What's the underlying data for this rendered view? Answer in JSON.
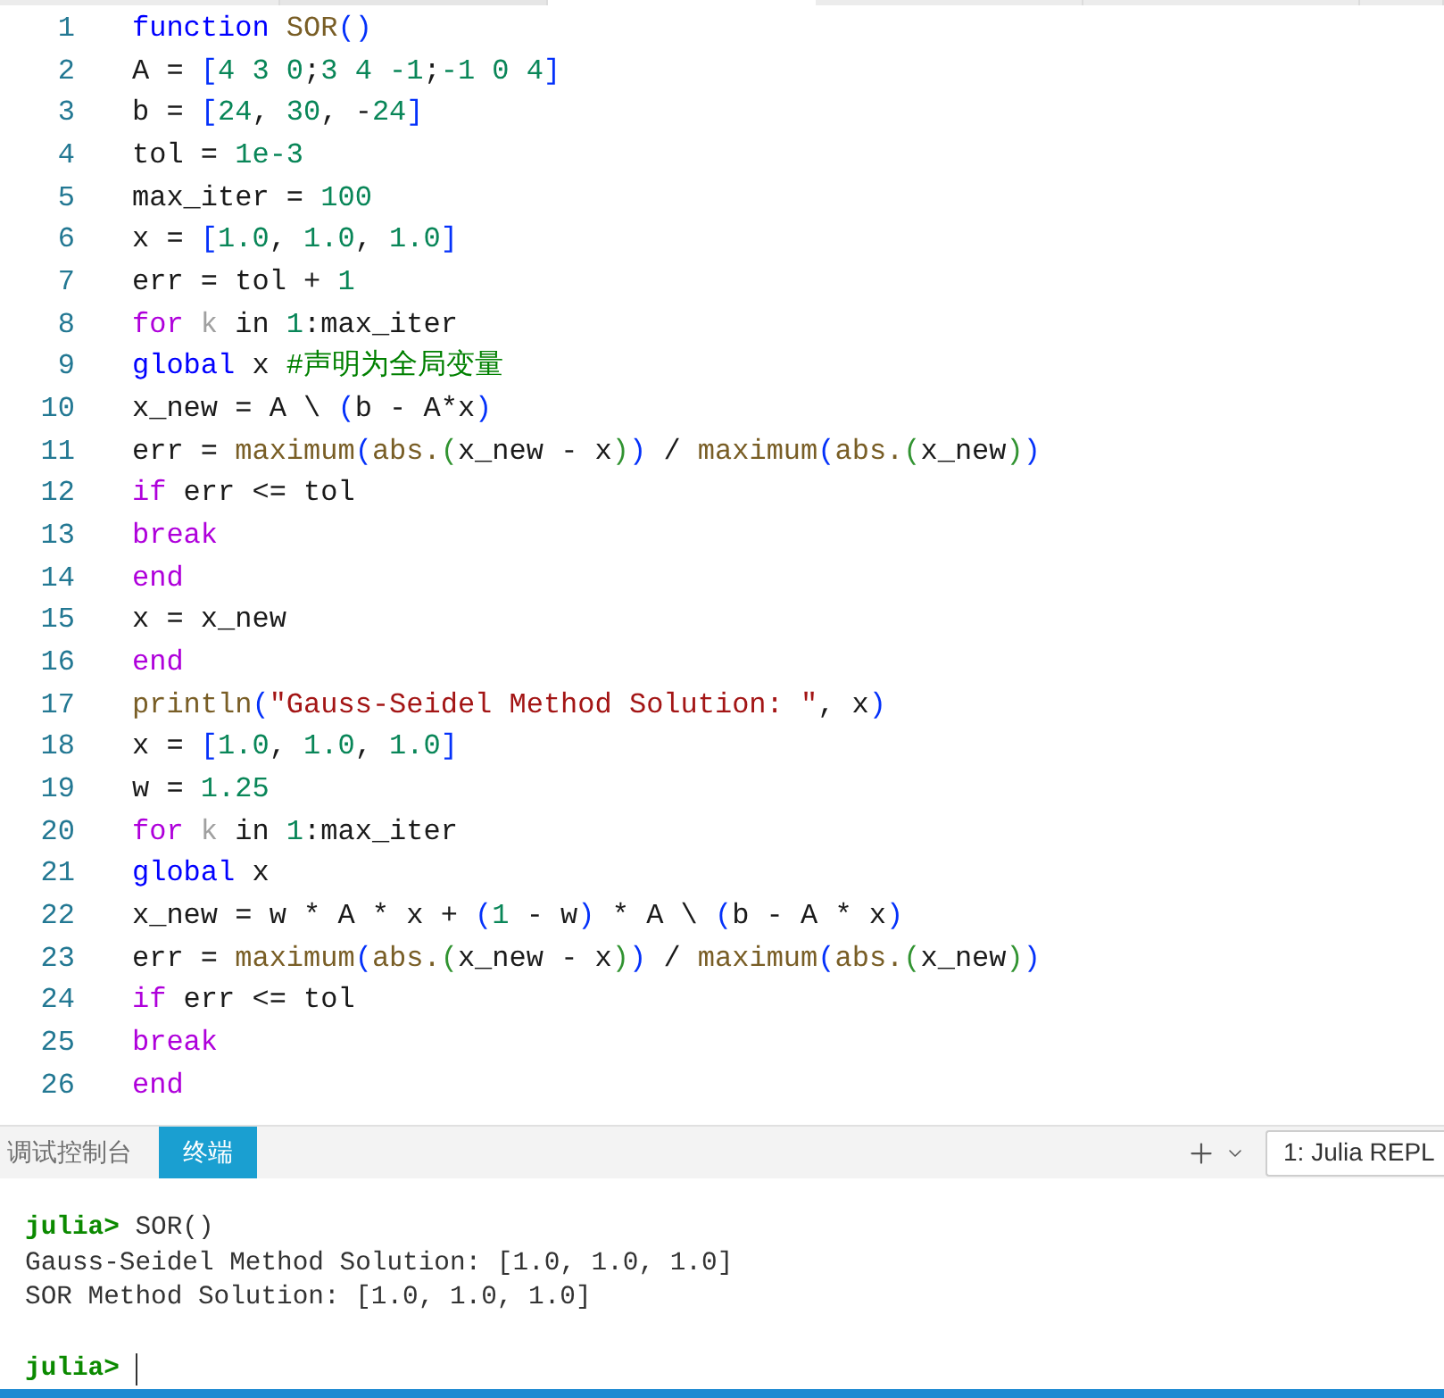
{
  "editor": {
    "lines": [
      {
        "number": "1",
        "tokens": [
          {
            "kind": "keyword",
            "text": "function "
          },
          {
            "kind": "function",
            "text": "SOR"
          },
          {
            "kind": "bracket_1",
            "text": "()"
          }
        ]
      },
      {
        "number": "2",
        "tokens": [
          {
            "kind": "plain",
            "text": "A = "
          },
          {
            "kind": "bracket_1",
            "text": "["
          },
          {
            "kind": "number",
            "text": "4 3 0"
          },
          {
            "kind": "plain",
            "text": ";"
          },
          {
            "kind": "number",
            "text": "3 4 -1"
          },
          {
            "kind": "plain",
            "text": ";"
          },
          {
            "kind": "number",
            "text": "-1 0 4"
          },
          {
            "kind": "bracket_1",
            "text": "]"
          }
        ]
      },
      {
        "number": "3",
        "tokens": [
          {
            "kind": "plain",
            "text": "b = "
          },
          {
            "kind": "bracket_1",
            "text": "["
          },
          {
            "kind": "number",
            "text": "24"
          },
          {
            "kind": "plain",
            "text": ", "
          },
          {
            "kind": "number",
            "text": "30"
          },
          {
            "kind": "plain",
            "text": ", -"
          },
          {
            "kind": "number",
            "text": "24"
          },
          {
            "kind": "bracket_1",
            "text": "]"
          }
        ]
      },
      {
        "number": "4",
        "tokens": [
          {
            "kind": "plain",
            "text": "tol = "
          },
          {
            "kind": "number",
            "text": "1e-3"
          }
        ]
      },
      {
        "number": "5",
        "tokens": [
          {
            "kind": "plain",
            "text": "max_iter = "
          },
          {
            "kind": "number",
            "text": "100"
          }
        ]
      },
      {
        "number": "6",
        "tokens": [
          {
            "kind": "plain",
            "text": "x = "
          },
          {
            "kind": "bracket_1",
            "text": "["
          },
          {
            "kind": "number",
            "text": "1.0"
          },
          {
            "kind": "plain",
            "text": ", "
          },
          {
            "kind": "number",
            "text": "1.0"
          },
          {
            "kind": "plain",
            "text": ", "
          },
          {
            "kind": "number",
            "text": "1.0"
          },
          {
            "kind": "bracket_1",
            "text": "]"
          }
        ]
      },
      {
        "number": "7",
        "tokens": [
          {
            "kind": "plain",
            "text": "err = tol + "
          },
          {
            "kind": "number",
            "text": "1"
          }
        ]
      },
      {
        "number": "8",
        "tokens": [
          {
            "kind": "control",
            "text": "for "
          },
          {
            "kind": "unused",
            "text": "k"
          },
          {
            "kind": "plain",
            "text": " in "
          },
          {
            "kind": "number",
            "text": "1"
          },
          {
            "kind": "plain",
            "text": ":max_iter"
          }
        ]
      },
      {
        "number": "9",
        "tokens": [
          {
            "kind": "keyword",
            "text": "global"
          },
          {
            "kind": "plain",
            "text": " x "
          },
          {
            "kind": "comment",
            "text": "#声明为全局变量"
          }
        ]
      },
      {
        "number": "10",
        "tokens": [
          {
            "kind": "plain",
            "text": "x_new = A \\ "
          },
          {
            "kind": "bracket_1",
            "text": "("
          },
          {
            "kind": "plain",
            "text": "b - A*x"
          },
          {
            "kind": "bracket_1",
            "text": ")"
          }
        ]
      },
      {
        "number": "11",
        "tokens": [
          {
            "kind": "plain",
            "text": "err = "
          },
          {
            "kind": "function",
            "text": "maximum"
          },
          {
            "kind": "bracket_1",
            "text": "("
          },
          {
            "kind": "function",
            "text": "abs."
          },
          {
            "kind": "bracket_2",
            "text": "("
          },
          {
            "kind": "plain",
            "text": "x_new - x"
          },
          {
            "kind": "bracket_2",
            "text": ")"
          },
          {
            "kind": "bracket_1",
            "text": ")"
          },
          {
            "kind": "plain",
            "text": " / "
          },
          {
            "kind": "function",
            "text": "maximum"
          },
          {
            "kind": "bracket_1",
            "text": "("
          },
          {
            "kind": "function",
            "text": "abs."
          },
          {
            "kind": "bracket_2",
            "text": "("
          },
          {
            "kind": "plain",
            "text": "x_new"
          },
          {
            "kind": "bracket_2",
            "text": ")"
          },
          {
            "kind": "bracket_1",
            "text": ")"
          }
        ]
      },
      {
        "number": "12",
        "tokens": [
          {
            "kind": "control",
            "text": "if"
          },
          {
            "kind": "plain",
            "text": " err <= tol"
          }
        ]
      },
      {
        "number": "13",
        "tokens": [
          {
            "kind": "control",
            "text": "break"
          }
        ]
      },
      {
        "number": "14",
        "tokens": [
          {
            "kind": "control",
            "text": "end"
          }
        ]
      },
      {
        "number": "15",
        "tokens": [
          {
            "kind": "plain",
            "text": "x = x_new"
          }
        ]
      },
      {
        "number": "16",
        "tokens": [
          {
            "kind": "control",
            "text": "end"
          }
        ]
      },
      {
        "number": "17",
        "tokens": [
          {
            "kind": "function",
            "text": "println"
          },
          {
            "kind": "bracket_1",
            "text": "("
          },
          {
            "kind": "string",
            "text": "\"Gauss-Seidel Method Solution: \""
          },
          {
            "kind": "plain",
            "text": ", x"
          },
          {
            "kind": "bracket_1",
            "text": ")"
          }
        ]
      },
      {
        "number": "18",
        "tokens": [
          {
            "kind": "plain",
            "text": "x = "
          },
          {
            "kind": "bracket_1",
            "text": "["
          },
          {
            "kind": "number",
            "text": "1.0"
          },
          {
            "kind": "plain",
            "text": ", "
          },
          {
            "kind": "number",
            "text": "1.0"
          },
          {
            "kind": "plain",
            "text": ", "
          },
          {
            "kind": "number",
            "text": "1.0"
          },
          {
            "kind": "bracket_1",
            "text": "]"
          }
        ]
      },
      {
        "number": "19",
        "tokens": [
          {
            "kind": "plain",
            "text": "w = "
          },
          {
            "kind": "number",
            "text": "1.25"
          }
        ]
      },
      {
        "number": "20",
        "tokens": [
          {
            "kind": "control",
            "text": "for "
          },
          {
            "kind": "unused",
            "text": "k"
          },
          {
            "kind": "plain",
            "text": " in "
          },
          {
            "kind": "number",
            "text": "1"
          },
          {
            "kind": "plain",
            "text": ":max_iter"
          }
        ]
      },
      {
        "number": "21",
        "tokens": [
          {
            "kind": "keyword",
            "text": "global"
          },
          {
            "kind": "plain",
            "text": " x"
          }
        ]
      },
      {
        "number": "22",
        "tokens": [
          {
            "kind": "plain",
            "text": "x_new = w * A * x + "
          },
          {
            "kind": "bracket_1",
            "text": "("
          },
          {
            "kind": "number",
            "text": "1"
          },
          {
            "kind": "plain",
            "text": " - w"
          },
          {
            "kind": "bracket_1",
            "text": ")"
          },
          {
            "kind": "plain",
            "text": " * A \\ "
          },
          {
            "kind": "bracket_1",
            "text": "("
          },
          {
            "kind": "plain",
            "text": "b - A * x"
          },
          {
            "kind": "bracket_1",
            "text": ")"
          }
        ]
      },
      {
        "number": "23",
        "tokens": [
          {
            "kind": "plain",
            "text": "err = "
          },
          {
            "kind": "function",
            "text": "maximum"
          },
          {
            "kind": "bracket_1",
            "text": "("
          },
          {
            "kind": "function",
            "text": "abs."
          },
          {
            "kind": "bracket_2",
            "text": "("
          },
          {
            "kind": "plain",
            "text": "x_new - x"
          },
          {
            "kind": "bracket_2",
            "text": ")"
          },
          {
            "kind": "bracket_1",
            "text": ")"
          },
          {
            "kind": "plain",
            "text": " / "
          },
          {
            "kind": "function",
            "text": "maximum"
          },
          {
            "kind": "bracket_1",
            "text": "("
          },
          {
            "kind": "function",
            "text": "abs."
          },
          {
            "kind": "bracket_2",
            "text": "("
          },
          {
            "kind": "plain",
            "text": "x_new"
          },
          {
            "kind": "bracket_2",
            "text": ")"
          },
          {
            "kind": "bracket_1",
            "text": ")"
          }
        ]
      },
      {
        "number": "24",
        "tokens": [
          {
            "kind": "control",
            "text": "if"
          },
          {
            "kind": "plain",
            "text": " err <= tol"
          }
        ]
      },
      {
        "number": "25",
        "tokens": [
          {
            "kind": "control",
            "text": "break"
          }
        ]
      },
      {
        "number": "26",
        "tokens": [
          {
            "kind": "control",
            "text": "end"
          }
        ]
      }
    ]
  },
  "panel": {
    "tabs": [
      {
        "label": "调试控制台",
        "selected": false
      },
      {
        "label": "终端",
        "selected": true
      }
    ],
    "terminal_selector": "1: Julia REPL"
  },
  "terminal": {
    "lines": [
      {
        "kind": "prompt",
        "prompt": "julia>",
        "text": "SOR()"
      },
      {
        "kind": "output",
        "text": "Gauss-Seidel Method Solution: [1.0, 1.0, 1.0]"
      },
      {
        "kind": "output",
        "text": "SOR Method Solution: [1.0, 1.0, 1.0]"
      },
      {
        "kind": "blank"
      },
      {
        "kind": "prompt",
        "prompt": "julia>",
        "cursor": true
      }
    ]
  }
}
